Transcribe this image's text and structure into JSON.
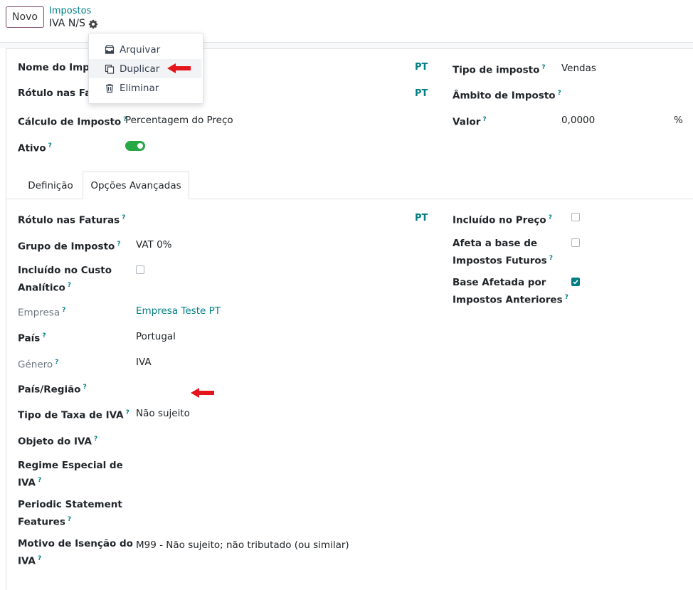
{
  "control_panel": {
    "new_button": "Novo",
    "breadcrumb_parent": "Impostos",
    "breadcrumb_current": "IVA N/S"
  },
  "action_menu": {
    "items": [
      {
        "label": "Arquivar",
        "icon": "archive-icon"
      },
      {
        "label": "Duplicar",
        "icon": "copy-icon"
      },
      {
        "label": "Eliminar",
        "icon": "trash-icon"
      }
    ]
  },
  "header_fields": {
    "tax_name_label": "Nome do Imposto",
    "invoice_label_label": "Rótulo nas Faturas",
    "computation_label": "Cálculo de Imposto",
    "computation_value": "Percentagem do Preço",
    "active_label": "Ativo",
    "active_value": true,
    "lang_code_1": "PT",
    "lang_code_2": "PT",
    "tax_type_label": "Tipo de imposto",
    "tax_type_value": "Vendas",
    "tax_scope_label": "Âmbito de Imposto",
    "amount_label": "Valor",
    "amount_value": "0,0000",
    "amount_unit": "%"
  },
  "help_mark": "?",
  "tabs": [
    {
      "label": "Definição",
      "active": false
    },
    {
      "label": "Opções Avançadas",
      "active": true
    }
  ],
  "advanced": {
    "invoice_label_label": "Rótulo nas Faturas",
    "lang_code": "PT",
    "tax_group_label": "Grupo de Imposto",
    "tax_group_value": "VAT 0%",
    "analytic_label_1": "Incluído no Custo",
    "analytic_label_2": "Analítico",
    "analytic_checked": false,
    "company_label": "Empresa",
    "company_value": "Empresa Teste PT",
    "country_label": "País",
    "country_value": "Portugal",
    "genre_label": "Género",
    "genre_value": "IVA",
    "region_label": "País/Região",
    "vat_rate_type_label": "Tipo de Taxa de IVA",
    "vat_rate_type_value": "Não sujeito",
    "vat_object_label": "Objeto do IVA",
    "special_regime_label_1": "Regime Especial de",
    "special_regime_label_2": "IVA",
    "periodic_label_1": "Periodic Statement",
    "periodic_label_2": "Features",
    "exemption_label_1": "Motivo de Isenção do",
    "exemption_label_2": "IVA",
    "exemption_value": "M99 - Não sujeito; não tributado (ou similar)",
    "price_include_label": "Incluído no Preço",
    "price_include_checked": false,
    "affects_base_label_1": "Afeta a base de",
    "affects_base_label_2": "Impostos Futuros",
    "affects_base_checked": false,
    "base_affected_label_1": "Base Afetada por",
    "base_affected_label_2": "Impostos Anteriores",
    "base_affected_checked": true
  },
  "colors": {
    "accent": "#017e84",
    "brand": "#7b4b6a",
    "toggle_on": "#28a745",
    "annotation_arrow": "#e4161b"
  }
}
